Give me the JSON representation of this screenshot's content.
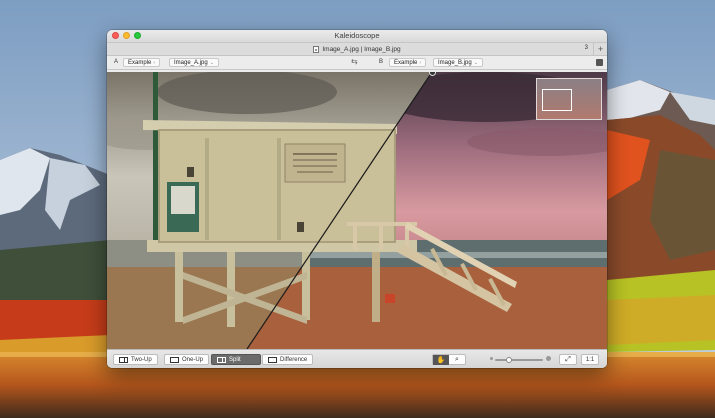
{
  "window": {
    "title": "Kaleidoscope"
  },
  "tab": {
    "label": "Image_A.jpg | Image_B.jpg",
    "count": "3",
    "add_label": "+"
  },
  "pathbar": {
    "a": {
      "letter": "A",
      "folder": "Example",
      "file": "Image_A.jpg"
    },
    "b": {
      "letter": "B",
      "folder": "Example",
      "file": "Image_B.jpg"
    },
    "swap_glyph": "⇆"
  },
  "toolbar": {
    "modes": [
      {
        "label": "Two-Up",
        "active": false
      },
      {
        "label": "One-Up",
        "active": false
      },
      {
        "label": "Split",
        "active": true
      },
      {
        "label": "Difference",
        "active": false
      }
    ],
    "pan_glyph": "✋",
    "zoom_glyph": "⌕",
    "zoom_level": 0.25,
    "fit_glyph": "⤢",
    "actual_size_label": "1:1"
  },
  "colors": {
    "accent_active": "#6b6b6b",
    "close": "#fc5f57",
    "minimize": "#fdbc2e",
    "maximize": "#29c840"
  }
}
